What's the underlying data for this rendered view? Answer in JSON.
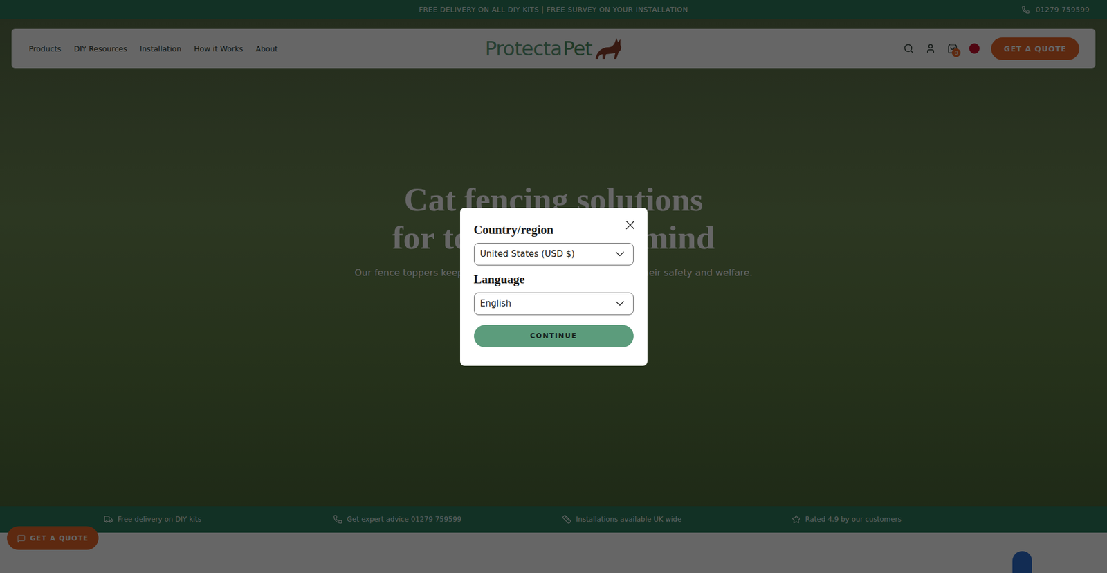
{
  "announcement": {
    "text": "FREE DELIVERY ON ALL DIY KITS | FREE SURVEY ON YOUR INSTALLATION",
    "phone": "01279 759599"
  },
  "nav": {
    "items": [
      "Products",
      "DIY Resources",
      "Installation",
      "How it Works",
      "About"
    ],
    "logo": {
      "first": "Protecta",
      "second": "Pet"
    },
    "cart_count": "0",
    "cta": "GET A QUOTE"
  },
  "hero": {
    "title_lines": [
      "Cat fencing solutions",
      "for total peace of mind"
    ],
    "subtitle": "Our fence toppers keep your cat safely contained, protecting their safety and welfare."
  },
  "features": [
    "Free delivery on DIY kits",
    "Get expert advice 01279 759599",
    "Installations available UK wide",
    "Rated 4.9 by our customers"
  ],
  "floating_button": "GET A QUOTE",
  "dialog": {
    "country_label": "Country/region",
    "country_value": "United States (USD $)",
    "language_label": "Language",
    "language_value": "English",
    "button": "CONTINUE"
  }
}
